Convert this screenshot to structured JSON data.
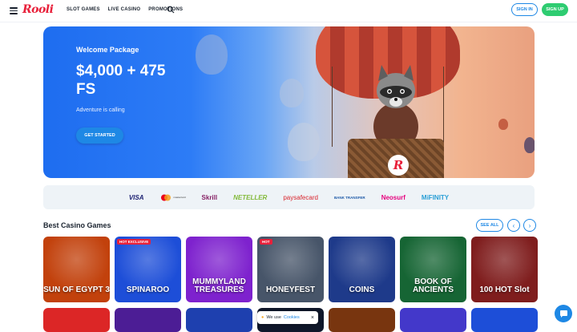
{
  "header": {
    "logo": "Rooli",
    "nav": [
      "SLOT GAMES",
      "LIVE CASINO",
      "PROMOTIONS"
    ],
    "sign_in": "SIGN IN",
    "sign_up": "SIGN UP"
  },
  "hero": {
    "title": "Welcome Package",
    "offer": "$4,000 + 475 FS",
    "subtitle": "Adventure is calling",
    "cta": "GET STARTED",
    "badge": "R"
  },
  "payments": [
    "VISA",
    "mastercard",
    "Skrill",
    "NETELLER",
    "paysafecard",
    "BANK TRANSFER",
    "Neosurf",
    "MiFINITY"
  ],
  "games_section": {
    "title": "Best Casino Games",
    "see_all": "SEE ALL",
    "prev": "‹",
    "next": "›"
  },
  "games": [
    {
      "name": "SUN OF EGYPT 3",
      "tag": "",
      "bg": "#c2410c"
    },
    {
      "name": "SPINAROO",
      "tag": "HOT EXCLUSIVE",
      "bg": "#1d4ed8"
    },
    {
      "name": "MUMMYLAND TREASURES",
      "tag": "",
      "bg": "#7e22ce"
    },
    {
      "name": "HONEYFEST",
      "tag": "HOT",
      "bg": "#475569"
    },
    {
      "name": "COINS",
      "tag": "",
      "bg": "#1e3a8a"
    },
    {
      "name": "BOOK OF ANCIENTS",
      "tag": "",
      "bg": "#166534"
    },
    {
      "name": "100 HOT Slot",
      "tag": "",
      "bg": "#7f1d1d"
    }
  ],
  "games_row2": [
    {
      "bg": "#dc2626"
    },
    {
      "bg": "#4c1d95"
    },
    {
      "bg": "#1e40af"
    },
    {
      "bg": "#0f172a"
    },
    {
      "bg": "#78350f"
    },
    {
      "bg": "#4338ca"
    },
    {
      "bg": "#1d4ed8"
    }
  ],
  "cookie": {
    "text": "We use",
    "link": "Cookies",
    "close": "×"
  },
  "colors": {
    "accent": "#1e88e5",
    "signup": "#2ecc71",
    "brand": "#e8203a"
  }
}
